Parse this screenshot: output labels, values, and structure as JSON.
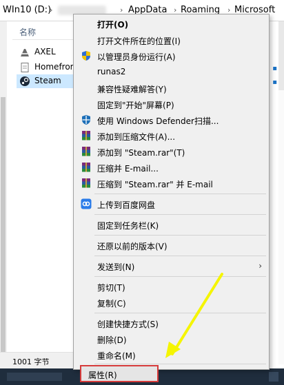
{
  "explorer": {
    "breadcrumb": [
      "WIn10 (D:)",
      "AppData",
      "Roaming",
      "Microsoft"
    ],
    "column_header": "名称",
    "files": [
      {
        "name": "AXEL",
        "icon": "app-icon"
      },
      {
        "name": "Homefror",
        "icon": "document-icon"
      },
      {
        "name": "Steam",
        "icon": "steam-icon"
      }
    ],
    "status": "1001 字节"
  },
  "menu": {
    "items": [
      {
        "label": "打开(O)",
        "bold": true
      },
      {
        "label": "打开文件所在的位置(I)"
      },
      {
        "label": "以管理员身份运行(A)",
        "icon": "shield-icon"
      },
      {
        "label": "runas2"
      },
      {
        "label": "兼容性疑难解答(Y)"
      },
      {
        "label": "固定到\"开始\"屏幕(P)"
      },
      {
        "label": "使用 Windows Defender扫描...",
        "icon": "defender-icon"
      },
      {
        "label": "添加到压缩文件(A)...",
        "icon": "winrar-icon"
      },
      {
        "label": "添加到 \"Steam.rar\"(T)",
        "icon": "winrar-icon"
      },
      {
        "label": "压缩并 E-mail...",
        "icon": "winrar-icon"
      },
      {
        "label": "压缩到 \"Steam.rar\" 并 E-mail",
        "icon": "winrar-icon"
      },
      {
        "label": "上传到百度网盘",
        "icon": "baidu-cloud-icon"
      },
      {
        "label": "固定到任务栏(K)"
      },
      {
        "label": "还原以前的版本(V)"
      },
      {
        "label": "发送到(N)",
        "submenu": true
      },
      {
        "label": "剪切(T)"
      },
      {
        "label": "复制(C)"
      },
      {
        "label": "创建快捷方式(S)"
      },
      {
        "label": "删除(D)"
      },
      {
        "label": "重命名(M)"
      },
      {
        "label": "属性(R)",
        "highlighted": true
      }
    ],
    "submenu_arrow": "›"
  },
  "colors": {
    "highlight_border": "#d63b3b",
    "arrow": "#f5f500",
    "selection": "#cce8ff"
  }
}
